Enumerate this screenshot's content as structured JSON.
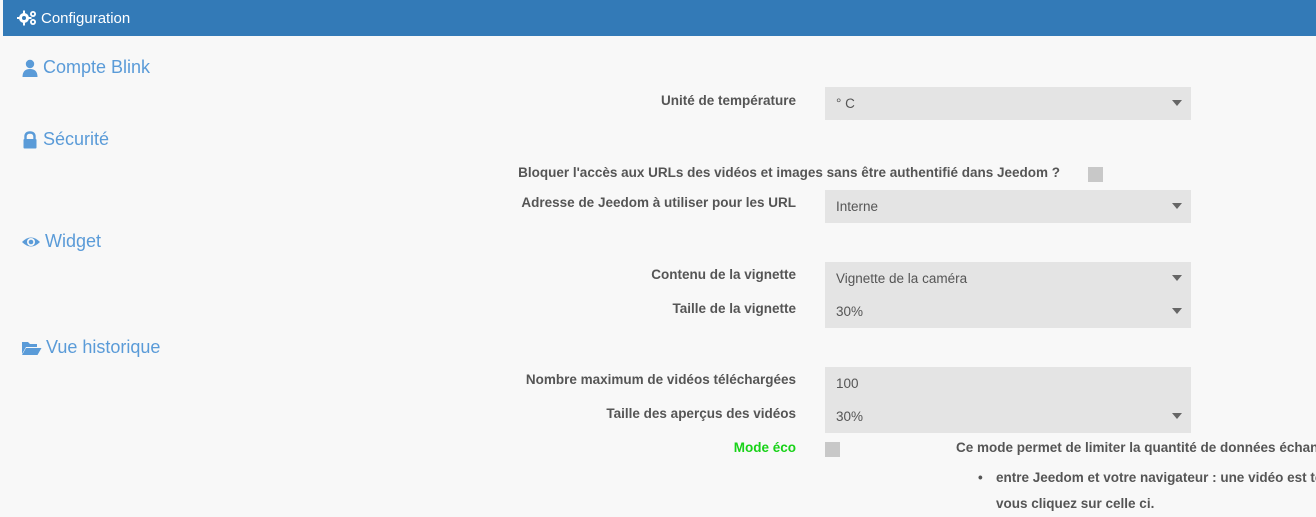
{
  "header": {
    "title": "Configuration",
    "icon": "gears-icon"
  },
  "sections": {
    "account": {
      "title": "Compte Blink",
      "icon": "user-icon"
    },
    "security": {
      "title": "Sécurité",
      "icon": "lock-icon"
    },
    "widget": {
      "title": "Widget",
      "icon": "eye-icon"
    },
    "history": {
      "title": "Vue historique",
      "icon": "folder-open-icon"
    }
  },
  "fields": {
    "temp_unit": {
      "label": "Unité de température",
      "value": "° C"
    },
    "block_access": {
      "label": "Bloquer l'accès aux URLs des vidéos et images sans être authentifié dans Jeedom ?",
      "checked": false
    },
    "jeedom_address": {
      "label": "Adresse de Jeedom à utiliser pour les URL",
      "value": "Interne"
    },
    "thumb_content": {
      "label": "Contenu de la vignette",
      "value": "Vignette de la caméra"
    },
    "thumb_size": {
      "label": "Taille de la vignette",
      "value": "30%"
    },
    "max_videos": {
      "label": "Nombre maximum de vidéos téléchargées",
      "value": "100"
    },
    "preview_size": {
      "label": "Taille des aperçus des vidéos",
      "value": "30%"
    },
    "eco_mode": {
      "label": "Mode éco",
      "checked": false
    }
  },
  "eco_info": {
    "text": "Ce mode permet de limiter la quantité de données échang",
    "bullet1": "entre Jeedom et votre navigateur : une vidéo est té",
    "bullet1_cont": "vous cliquez sur celle ci."
  },
  "colors": {
    "header_bg": "#337ab7",
    "section_title": "#5a9bd8",
    "eco_label": "#18d218"
  }
}
